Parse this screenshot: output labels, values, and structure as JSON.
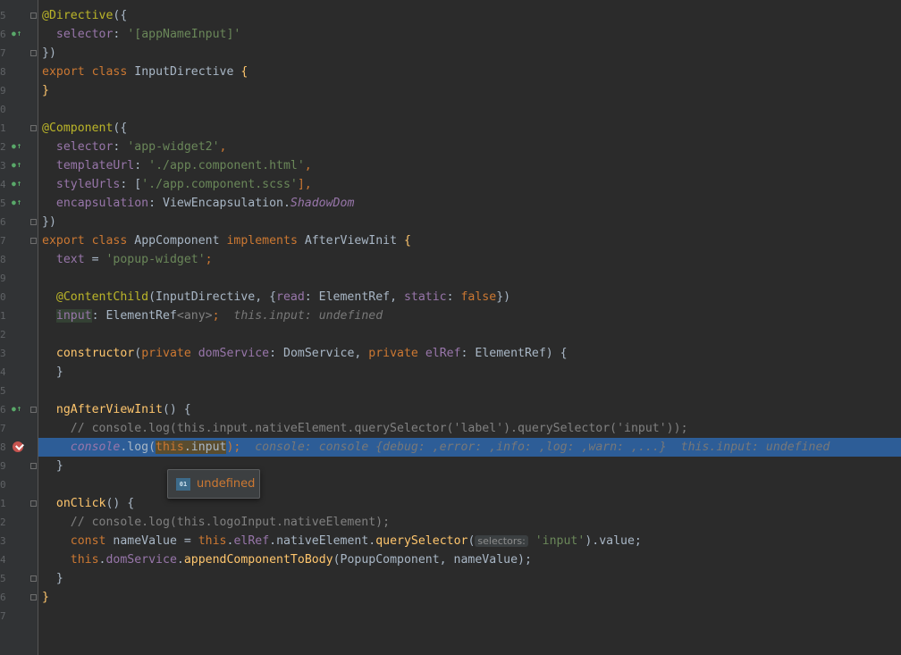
{
  "gutter": {
    "line_numbers": [
      "5",
      "6",
      "7",
      "8",
      "9",
      "0",
      "1",
      "2",
      "3",
      "4",
      "5",
      "6",
      "7",
      "8",
      "9",
      "0",
      "1",
      "2",
      "3",
      "4",
      "5",
      "6",
      "7",
      "8",
      "9",
      "0",
      "1",
      "2",
      "3",
      "4",
      "5",
      "6",
      "7"
    ],
    "implements_icon": "implemented-property-icon",
    "breakpoint_icon": "breakpoint-icon"
  },
  "code": {
    "l1": {
      "a": "@Directive",
      "b": "({"
    },
    "l2": {
      "prop": "selector",
      "colon": ": ",
      "str": "'[appNameInput]'"
    },
    "l3": {
      "t": "})"
    },
    "l4": {
      "kw1": "export",
      "kw2": "class",
      "name": "InputDirective",
      "brace": "{"
    },
    "l5": {
      "t": "}"
    },
    "l7": {
      "a": "@Component",
      "b": "({"
    },
    "l8": {
      "prop": "selector",
      "colon": ": ",
      "str": "'app-widget2'",
      "tail": ","
    },
    "l9": {
      "prop": "templateUrl",
      "colon": ": ",
      "str": "'./app.component.html'",
      "tail": ","
    },
    "l10": {
      "prop": "styleUrls",
      "colon": ": [",
      "str": "'./app.component.scss'",
      "tail": "],"
    },
    "l11": {
      "prop": "encapsulation",
      "colon": ": ",
      "cls": "ViewEncapsulation.",
      "member": "ShadowDom"
    },
    "l12": {
      "t": "})"
    },
    "l13": {
      "kw1": "export",
      "kw2": "class",
      "name": "AppComponent",
      "kw3": "implements",
      "iface": "AfterViewInit",
      "brace": "{"
    },
    "l14": {
      "prop": "text",
      "eq": " = ",
      "str": "'popup-widget'",
      "tail": ";"
    },
    "l16": {
      "ann": "@ContentChild",
      "p1": "(InputDirective, {",
      "k1": "read",
      "p2": ": ElementRef, ",
      "k2": "static",
      "p3": ": ",
      "kwf": "false",
      "p4": "})"
    },
    "l17": {
      "prop": "input",
      "p1": ": ElementRef",
      "gen": "<any>",
      "semi": ";",
      "hint": "this.input: undefined"
    },
    "l19": {
      "fn": "constructor",
      "p1": "(",
      "kw1": "private",
      "prop1": "domService",
      "p2": ": DomService, ",
      "kw2": "private",
      "prop2": "elRef",
      "p3": ": ElementRef) {"
    },
    "l20": {
      "t": "}"
    },
    "l22": {
      "fn": "ngAfterViewInit",
      "p1": "() {"
    },
    "l23": {
      "cmt": "// console.log(this.input.nativeElement.querySelector('label').querySelector('input'));"
    },
    "l24": {
      "obj": "console",
      "p1": ".log(",
      "kwthis": "this",
      "p2": ".input",
      "p3": ");",
      "hint": "console: console {debug: ,error: ,info: ,log: ,warn: ,...}",
      "hint2": "this.input: undefined"
    },
    "l25": {
      "t": "}"
    },
    "l27": {
      "fn": "onClick",
      "p1": "() {"
    },
    "l28": {
      "cmt": "// console.log(this.logoInput.nativeElement);"
    },
    "l29": {
      "kw": "const",
      "var": "nameValue",
      "p1": " = ",
      "kwthis": "this",
      "p2": ".",
      "prop": "elRef",
      "p3": ".nativeElement.",
      "fn": "querySelector",
      "p4": "(",
      "pill": "selectors:",
      "str": "'input'",
      "p5": ").value;"
    },
    "l30": {
      "kwthis": "this",
      "p1": ".",
      "prop": "domService",
      "p2": ".",
      "fn": "appendComponentToBody",
      "p3": "(PopupComponent, nameValue);"
    },
    "l31": {
      "t": "}"
    },
    "l32": {
      "t": "}"
    }
  },
  "tooltip": {
    "icon_text": "01",
    "value": "undefined"
  },
  "colors": {
    "background": "#2b2b2b",
    "execution_line": "#2d5d97",
    "keyword": "#cc7832",
    "string": "#6a8759",
    "property": "#9876aa",
    "annotation": "#bbb529",
    "function": "#ffc66d"
  }
}
